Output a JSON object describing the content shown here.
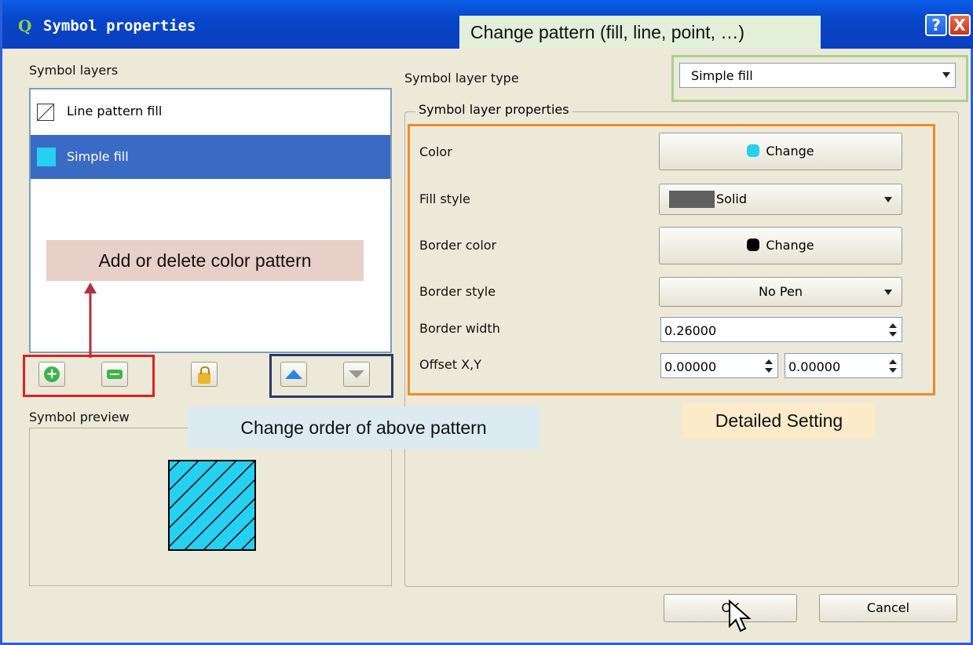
{
  "window": {
    "title": "Symbol properties",
    "help_glyph": "?",
    "close_glyph": "X",
    "app_glyph": "Q"
  },
  "left": {
    "symbol_layers_label": "Symbol layers",
    "layers": [
      {
        "label": "Line pattern fill",
        "swatch": "line-pattern-icon",
        "selected": false
      },
      {
        "label": "Simple fill",
        "swatch": "#25d0f0",
        "selected": true
      }
    ],
    "symbol_preview_label": "Symbol preview"
  },
  "right": {
    "symbol_layer_type_label": "Symbol layer type",
    "symbol_layer_type_value": "Simple fill",
    "properties_group_label": "Symbol layer properties",
    "color_label": "Color",
    "color_button": "Change",
    "color_value": "#25d0f0",
    "fill_style_label": "Fill style",
    "fill_style_value": "Solid",
    "border_color_label": "Border color",
    "border_color_button": "Change",
    "border_color_value": "#000000",
    "border_style_label": "Border style",
    "border_style_value": "No Pen",
    "border_width_label": "Border width",
    "border_width_value": "0.26000",
    "offset_label": "Offset X,Y",
    "offset_x": "0.00000",
    "offset_y": "0.00000"
  },
  "buttons": {
    "ok": "OK",
    "cancel": "Cancel"
  },
  "callouts": {
    "change_pattern": "Change pattern (fill, line, point, …)",
    "add_delete": "Add or delete color pattern",
    "change_order": "Change order of above pattern",
    "detailed_setting": "Detailed Setting"
  },
  "colors": {
    "titlebar": "#0845c8",
    "selection": "#3a6bc4",
    "green_outline": "#a9d18e",
    "orange_outline": "#f08a28",
    "red_outline": "#e02020",
    "navy_outline": "#2b3a66"
  }
}
